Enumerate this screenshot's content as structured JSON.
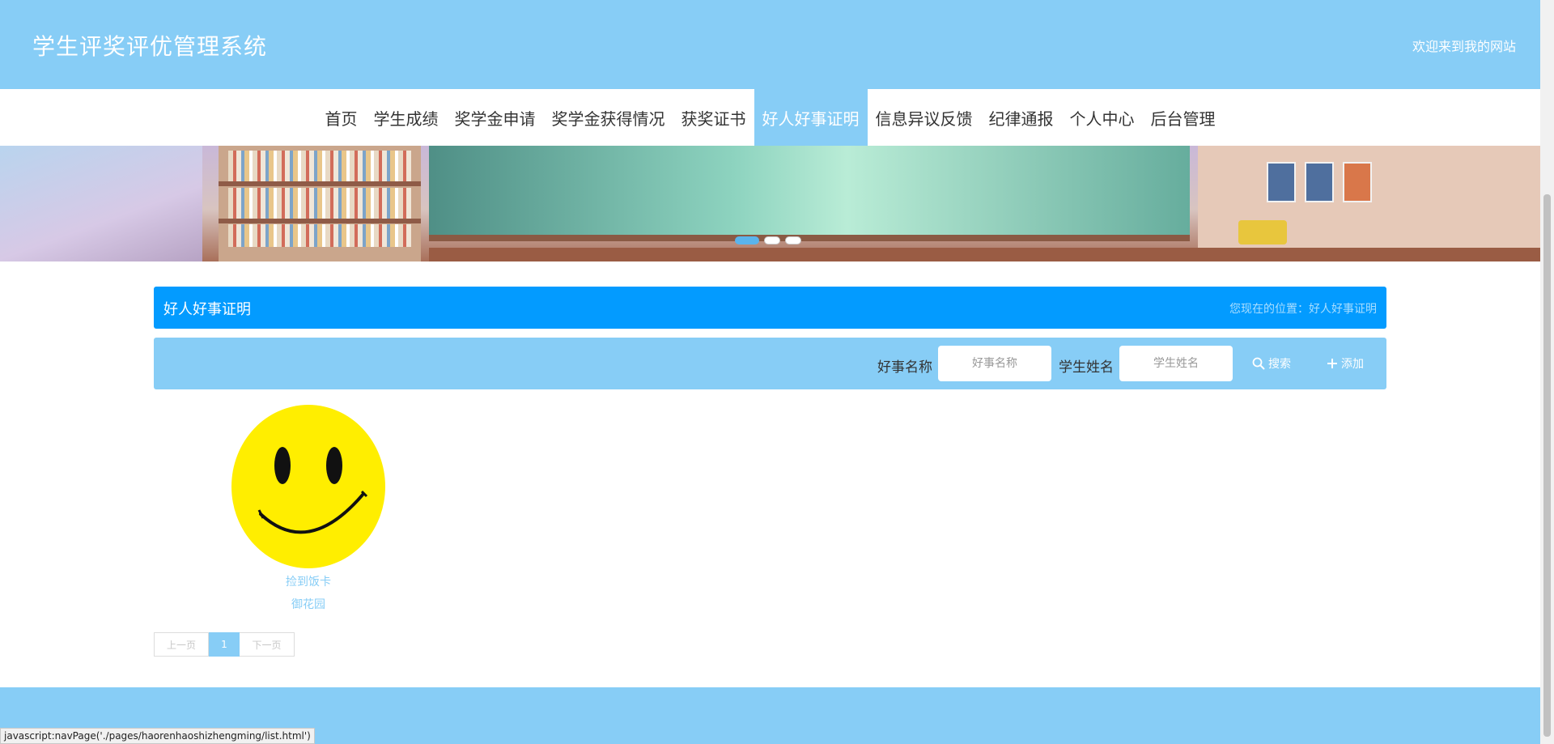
{
  "header": {
    "title": "学生评奖评优管理系统",
    "welcome": "欢迎来到我的网站"
  },
  "nav": {
    "items": [
      "首页",
      "学生成绩",
      "奖学金申请",
      "奖学金获得情况",
      "获奖证书",
      "好人好事证明",
      "信息异议反馈",
      "纪律通报",
      "个人中心",
      "后台管理"
    ],
    "active_index": 5
  },
  "banner": {
    "slides": 3,
    "active_slide": 1
  },
  "section": {
    "title": "好人好事证明",
    "location": "您现在的位置：好人好事证明"
  },
  "search": {
    "label1": "好事名称",
    "placeholder1": "好事名称",
    "label2": "学生姓名",
    "placeholder2": "学生姓名",
    "search_label": "搜索",
    "add_label": "添加",
    "search_icon": "search-icon",
    "add_icon": "plus-icon"
  },
  "list": {
    "items": [
      {
        "name": "捡到饭卡",
        "place": "御花园",
        "image": "smiley-face-image"
      }
    ]
  },
  "pager": {
    "prev": "上一页",
    "current": "1",
    "next": "下一页"
  },
  "status_bar": {
    "text": "javascript:navPage('./pages/haorenhaoshizhengming/list.html')"
  },
  "colors": {
    "primary": "#87cdf6",
    "title_bar": "#039bff",
    "smiley_yellow": "#ffee00"
  }
}
